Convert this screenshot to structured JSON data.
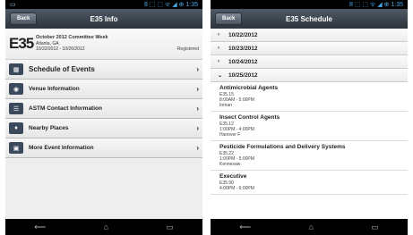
{
  "left": {
    "status": {
      "left": "▭",
      "right": "8 ⬚ ⬚ ᯤ ◢ ⊕ 1:35"
    },
    "header": {
      "back": "Back",
      "title": "E35 Info"
    },
    "event": {
      "code": "E35",
      "name": "October 2012 Committee Week",
      "location": "Atlanta, GA",
      "dates": "10/22/2012 - 10/26/2012",
      "status": "Registered"
    },
    "menu": [
      {
        "label": "Schedule of Events",
        "icon": "calendar-icon"
      },
      {
        "label": "Venue Information",
        "icon": "location-icon"
      },
      {
        "label": "ASTM Contact Information",
        "icon": "contact-icon"
      },
      {
        "label": "Nearby Places",
        "icon": "pin-icon"
      },
      {
        "label": "More Event Information",
        "icon": "info-icon"
      }
    ]
  },
  "right": {
    "status": {
      "left": "",
      "right": "8 ⬚ ⬚ ᯤ ◢ ⊕ 1:35"
    },
    "header": {
      "back": "Back",
      "title": "E35 Schedule"
    },
    "dates": [
      {
        "label": "10/22/2012",
        "expanded": false
      },
      {
        "label": "10/23/2012",
        "expanded": false
      },
      {
        "label": "10/24/2012",
        "expanded": false
      },
      {
        "label": "10/25/2012",
        "expanded": true
      }
    ],
    "sessions": [
      {
        "name": "Antimicrobial Agents",
        "code": "E35.15",
        "time": "8:00AM - 5:00PM",
        "room": "Inman"
      },
      {
        "name": "Insect Control Agents",
        "code": "E35.12",
        "time": "1:00PM - 4:00PM",
        "room": "Hanover F"
      },
      {
        "name": "Pesticide Formulations and Delivery Systems",
        "code": "E35.22",
        "time": "1:00PM - 5:00PM",
        "room": "Kennesaw"
      },
      {
        "name": "Executive",
        "code": "E35.90",
        "time": "4:00PM - 6:00PM",
        "room": ""
      }
    ]
  },
  "navbar": {
    "back": "⟵",
    "home": "⌂",
    "recent": "▭"
  }
}
